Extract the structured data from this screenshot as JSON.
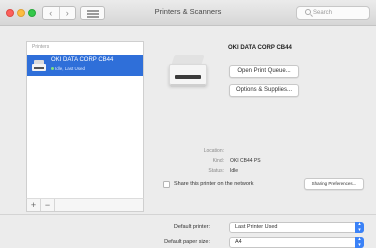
{
  "window": {
    "title": "Printers & Scanners"
  },
  "toolbar": {
    "back_glyph": "‹",
    "forward_glyph": "›",
    "search_placeholder": "Search"
  },
  "sidebar": {
    "header": "Printers",
    "printers": [
      {
        "name": "OKI DATA CORP CB44",
        "status": "Idle, Last Used",
        "selected": true
      }
    ],
    "add_label": "+",
    "remove_label": "−"
  },
  "detail": {
    "printer_name": "OKI DATA CORP CB44",
    "open_queue_label": "Open Print Queue...",
    "options_label": "Options & Supplies...",
    "location_label": "Location:",
    "location_value": "",
    "kind_label": "Kind:",
    "kind_value": "OKI CB44 PS",
    "status_label": "Status:",
    "status_value": "Idle",
    "share_label": "Share this printer on the network",
    "share_checked": false,
    "sharing_prefs_label": "Sharing Preferences..."
  },
  "footer": {
    "default_printer_label": "Default printer:",
    "default_printer_value": "Last Printer Used",
    "default_paper_label": "Default paper size:",
    "default_paper_value": "A4"
  },
  "colors": {
    "selection": "#2f6fd9",
    "popup_accent": "#3b82f7"
  }
}
